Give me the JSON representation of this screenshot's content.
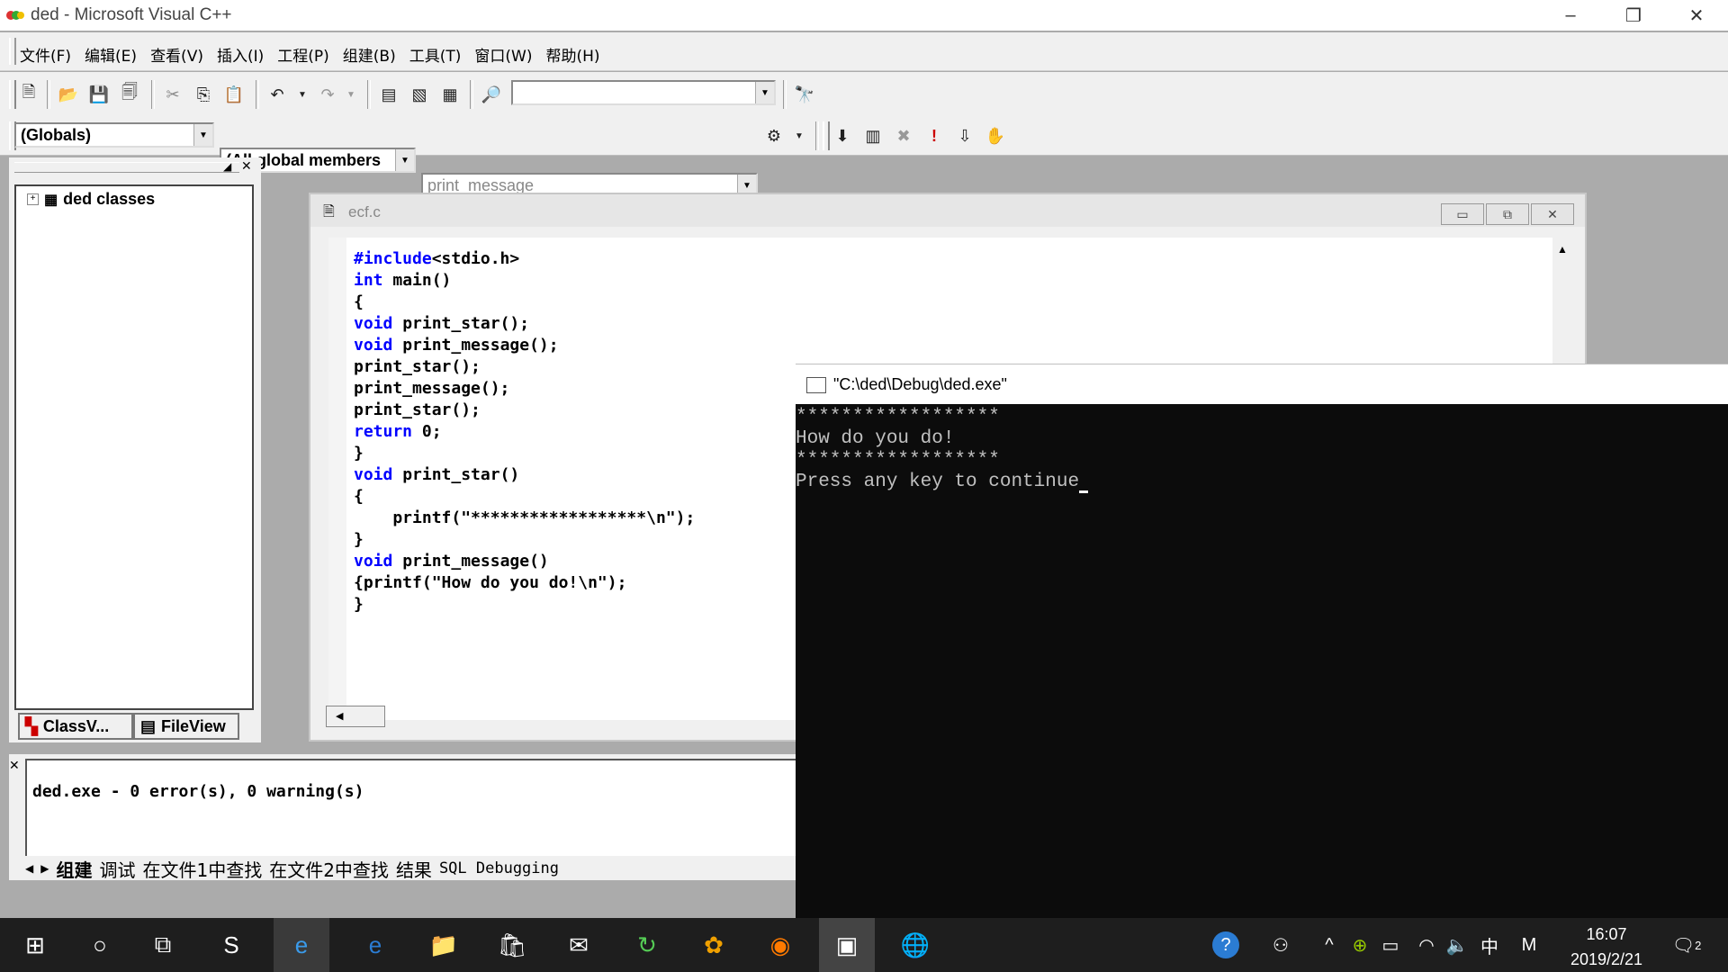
{
  "window": {
    "title": "ded - Microsoft Visual C++"
  },
  "menu": [
    "文件(F)",
    "编辑(E)",
    "查看(V)",
    "插入(I)",
    "工程(P)",
    "组建(B)",
    "工具(T)",
    "窗口(W)",
    "帮助(H)"
  ],
  "wizardbar": {
    "class_combo": "(Globals)",
    "members_combo": "(All global members",
    "function_combo": "print_message"
  },
  "workspace": {
    "root": "ded classes",
    "tabs": [
      "ClassV...",
      "FileView"
    ]
  },
  "editor": {
    "title": "ecf.c",
    "lines": [
      [
        "#include",
        "<stdio.h>"
      ],
      [
        "int",
        " main()"
      ],
      [
        "",
        "{"
      ],
      [
        "void",
        " print_star();"
      ],
      [
        "void",
        " print_message();"
      ],
      [
        "",
        "print_star();"
      ],
      [
        "",
        "print_message();"
      ],
      [
        "",
        "print_star();"
      ],
      [
        "return",
        " 0;"
      ],
      [
        "",
        "}"
      ],
      [
        "void",
        " print_star()"
      ],
      [
        "",
        "{"
      ],
      [
        "",
        "    printf(\"******************\\n\");"
      ],
      [
        "",
        "}"
      ],
      [
        "void",
        " print_message()"
      ],
      [
        "",
        "{printf(\"How do you do!\\n\");"
      ],
      [
        "",
        "}"
      ]
    ]
  },
  "console": {
    "title": "\"C:\\ded\\Debug\\ded.exe\"",
    "lines": [
      "******************",
      "How do you do!",
      "******************",
      "Press any key to continue"
    ]
  },
  "output": {
    "text": "ded.exe - 0 error(s), 0 warning(s)",
    "tabs": [
      "组建",
      "调试",
      "在文件1中查找",
      "在文件2中查找",
      "结果",
      "SQL Debugging"
    ]
  },
  "taskbar": {
    "time": "16:07",
    "date": "2019/2/21",
    "ime": "中",
    "notifications": "2"
  },
  "colors": {
    "keyword": "#0000ff",
    "console_bg": "#0c0c0c",
    "taskbar_bg": "#1e1e1e"
  }
}
